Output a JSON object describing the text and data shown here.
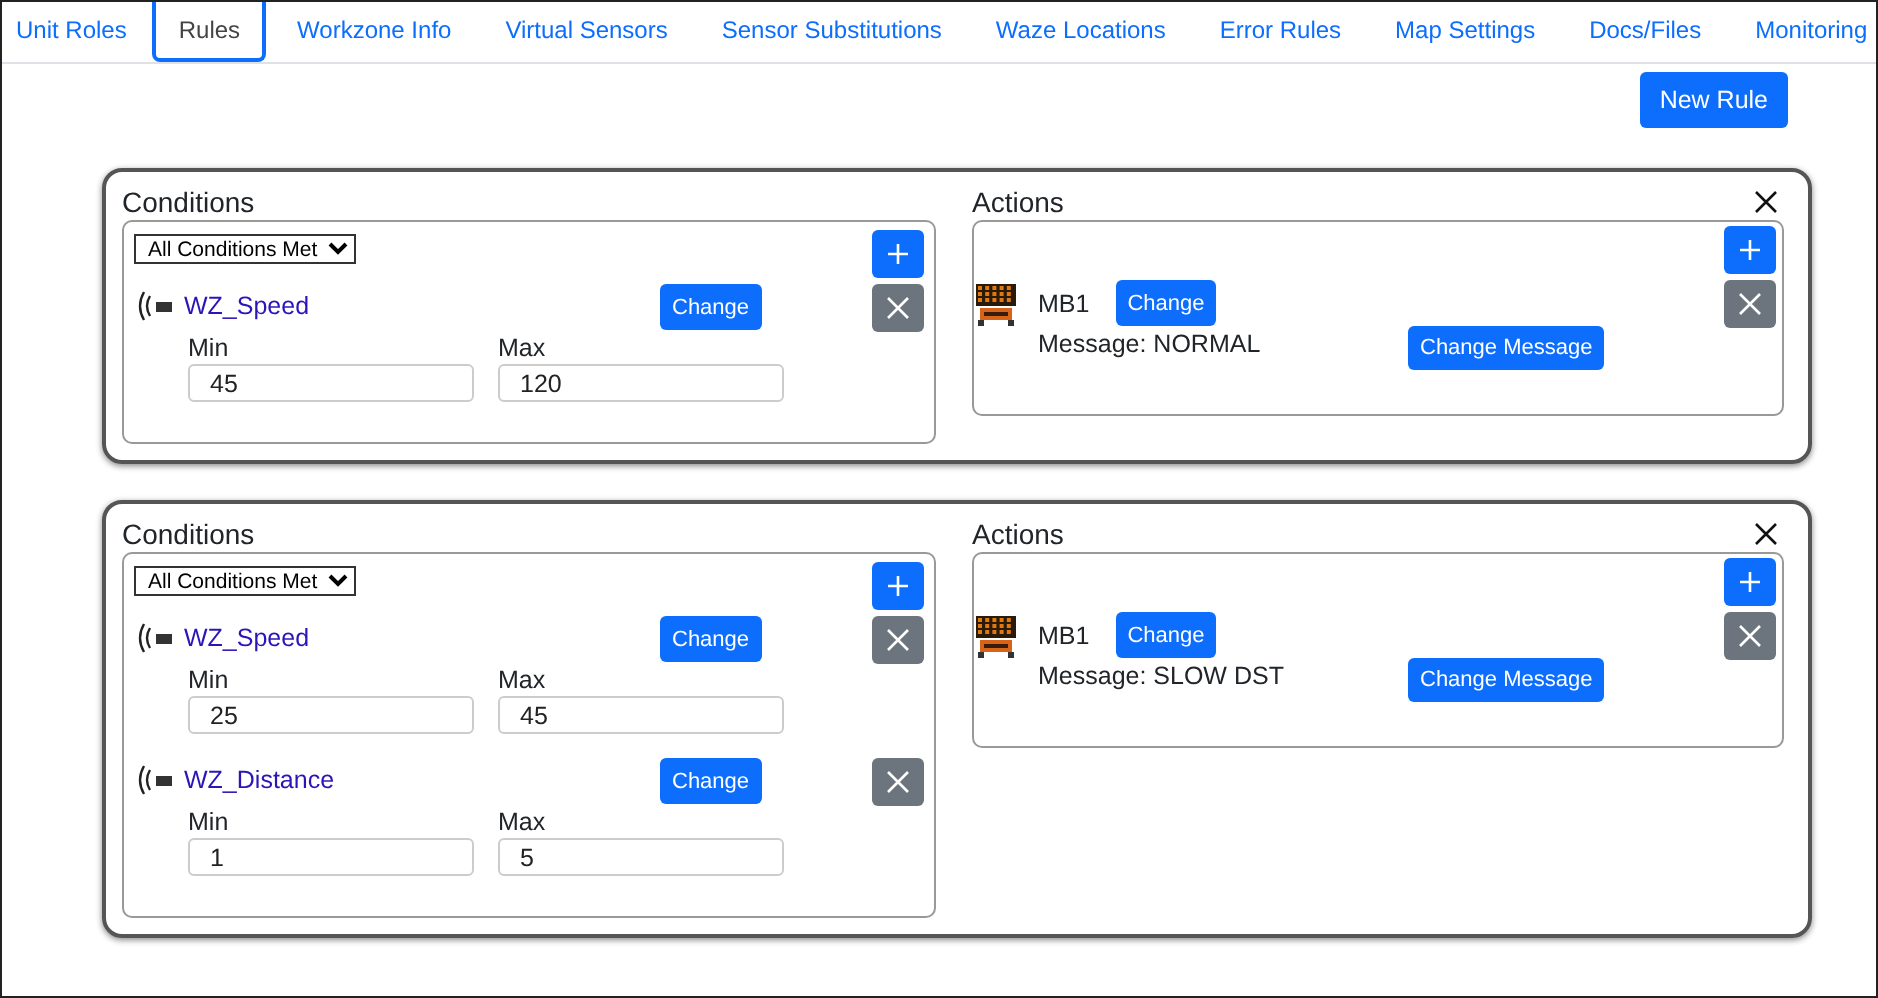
{
  "tabs": [
    {
      "label": "Unit Roles",
      "selected": false
    },
    {
      "label": "Rules",
      "selected": true
    },
    {
      "label": "Workzone Info",
      "selected": false
    },
    {
      "label": "Virtual Sensors",
      "selected": false
    },
    {
      "label": "Sensor Substitutions",
      "selected": false
    },
    {
      "label": "Waze Locations",
      "selected": false
    },
    {
      "label": "Error Rules",
      "selected": false
    },
    {
      "label": "Map Settings",
      "selected": false
    },
    {
      "label": "Docs/Files",
      "selected": false
    },
    {
      "label": "Monitoring",
      "selected": false
    }
  ],
  "new_rule_button": "New Rule",
  "rules": [
    {
      "conditions": {
        "title": "Conditions",
        "mode": "All Conditions Met",
        "items": [
          {
            "sensor": "WZ_Speed",
            "change": "Change",
            "min_label": "Min",
            "min": "45",
            "max_label": "Max",
            "max": "120"
          }
        ]
      },
      "actions": {
        "title": "Actions",
        "items": [
          {
            "device": "MB1",
            "change": "Change",
            "message": "Message: NORMAL",
            "change_message": "Change Message"
          }
        ]
      }
    },
    {
      "conditions": {
        "title": "Conditions",
        "mode": "All Conditions Met",
        "items": [
          {
            "sensor": "WZ_Speed",
            "change": "Change",
            "min_label": "Min",
            "min": "25",
            "max_label": "Max",
            "max": "45"
          },
          {
            "sensor": "WZ_Distance",
            "change": "Change",
            "min_label": "Min",
            "min": "1",
            "max_label": "Max",
            "max": "5"
          }
        ]
      },
      "actions": {
        "title": "Actions",
        "items": [
          {
            "device": "MB1",
            "change": "Change",
            "message": "Message: SLOW DST",
            "change_message": "Change Message"
          }
        ]
      }
    }
  ]
}
